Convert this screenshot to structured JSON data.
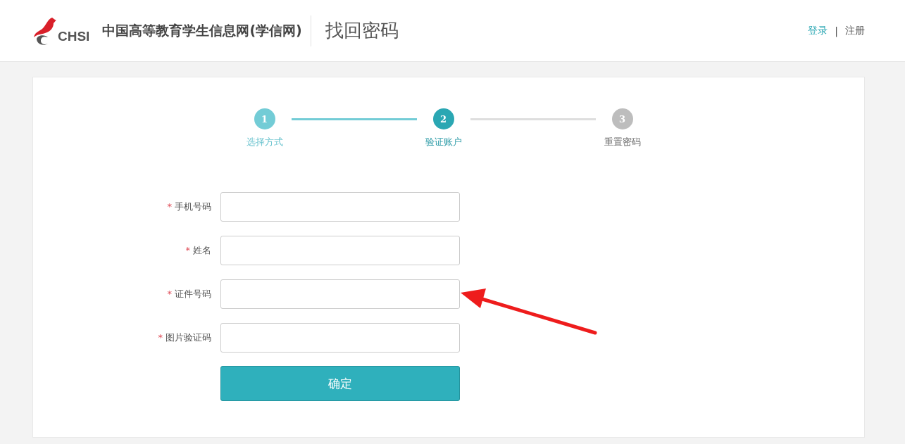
{
  "header": {
    "logo_text": "CHSI",
    "site_name": "中国高等教育学生信息网(学信网)",
    "page_title": "找回密码",
    "links": [
      {
        "label": "登录",
        "kind": "accent"
      },
      {
        "label": "注册",
        "kind": "plain"
      }
    ],
    "separator": "|"
  },
  "steps": [
    {
      "number": "1",
      "label": "选择方式",
      "done": true,
      "selected": false
    },
    {
      "number": "2",
      "label": "验证账户",
      "done": false,
      "selected": true
    },
    {
      "number": "3",
      "label": "重置密码",
      "done": false,
      "selected": false
    }
  ],
  "form": {
    "fields": [
      {
        "label": "手机号码",
        "required": true
      },
      {
        "label": "姓名",
        "required": true
      },
      {
        "label": "证件号码",
        "required": true
      },
      {
        "label": "图片验证码",
        "required": true
      }
    ],
    "required_mark": "*",
    "submit": "确定"
  },
  "annotation": {
    "kind": "arrow"
  }
}
